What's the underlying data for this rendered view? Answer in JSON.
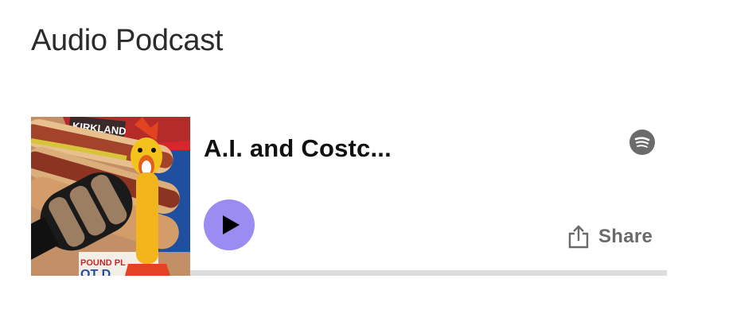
{
  "section": {
    "title": "Audio Podcast"
  },
  "player": {
    "episode_title": "A.I. and Costc...",
    "share_label": "Share",
    "progress_percent": 0,
    "accent_color": "#9b8cf2",
    "icons": {
      "platform": "spotify-icon",
      "play": "play-icon",
      "share": "share-icon"
    },
    "artwork": {
      "brand_text": "KIRKLAND",
      "package_text": "POUND PL",
      "package_text_2": "OT D"
    }
  }
}
